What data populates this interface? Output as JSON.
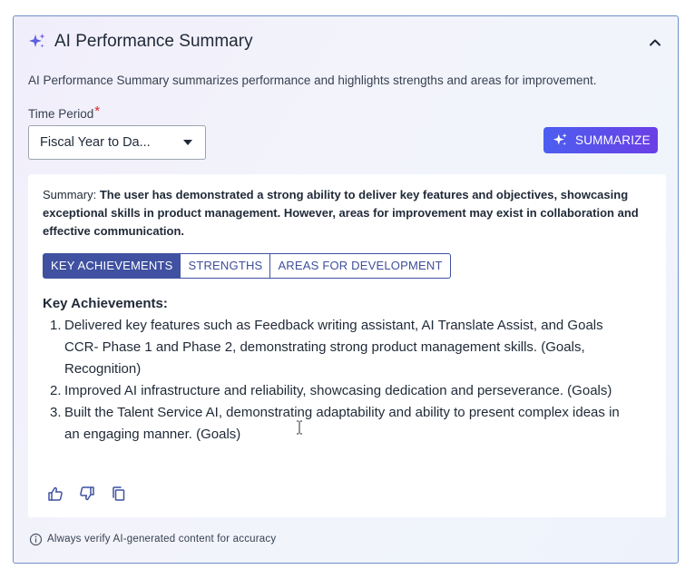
{
  "header": {
    "title": "AI Performance Summary",
    "icon": "sparkle-icon",
    "collapse_icon": "chevron-up-icon"
  },
  "description": "AI Performance Summary summarizes performance and highlights strengths and areas for improvement.",
  "time_period": {
    "label": "Time Period",
    "required_marker": "*",
    "selected": "Fiscal Year to Da..."
  },
  "summarize_button": {
    "label": "SUMMARIZE",
    "icon": "sparkle-icon"
  },
  "colors": {
    "accent": "#3f51a0",
    "button_start": "#4c5ef0",
    "button_end": "#6b3fe6",
    "required": "#dc2626",
    "border": "#6f8fc9"
  },
  "summary": {
    "prefix": "Summary: ",
    "text": "The user has demonstrated a strong ability to deliver key features and objectives, showcasing exceptional skills in product management. However, areas for improvement may exist in collaboration and effective communication."
  },
  "tabs": [
    {
      "label": "KEY ACHIEVEMENTS",
      "active": true
    },
    {
      "label": "STRENGTHS",
      "active": false
    },
    {
      "label": "AREAS FOR DEVELOPMENT",
      "active": false
    }
  ],
  "key_achievements": {
    "heading": "Key Achievements:",
    "items": [
      {
        "num": "1.",
        "text": "Delivered key features such as Feedback writing assistant, AI Translate Assist, and Goals CCR- Phase 1 and Phase 2, demonstrating strong product management skills. (Goals, Recognition)"
      },
      {
        "num": "2.",
        "text": "Improved AI infrastructure and reliability, showcasing dedication and perseverance. (Goals)"
      },
      {
        "num": "3.",
        "text": "Built the Talent Service AI, demonstrating adaptability and ability to present complex ideas in an engaging manner. (Goals)"
      }
    ]
  },
  "actions": [
    "thumbs-up-icon",
    "thumbs-down-icon",
    "copy-icon"
  ],
  "footer": {
    "text": "Always verify AI-generated content for accuracy",
    "icon": "info-icon"
  }
}
